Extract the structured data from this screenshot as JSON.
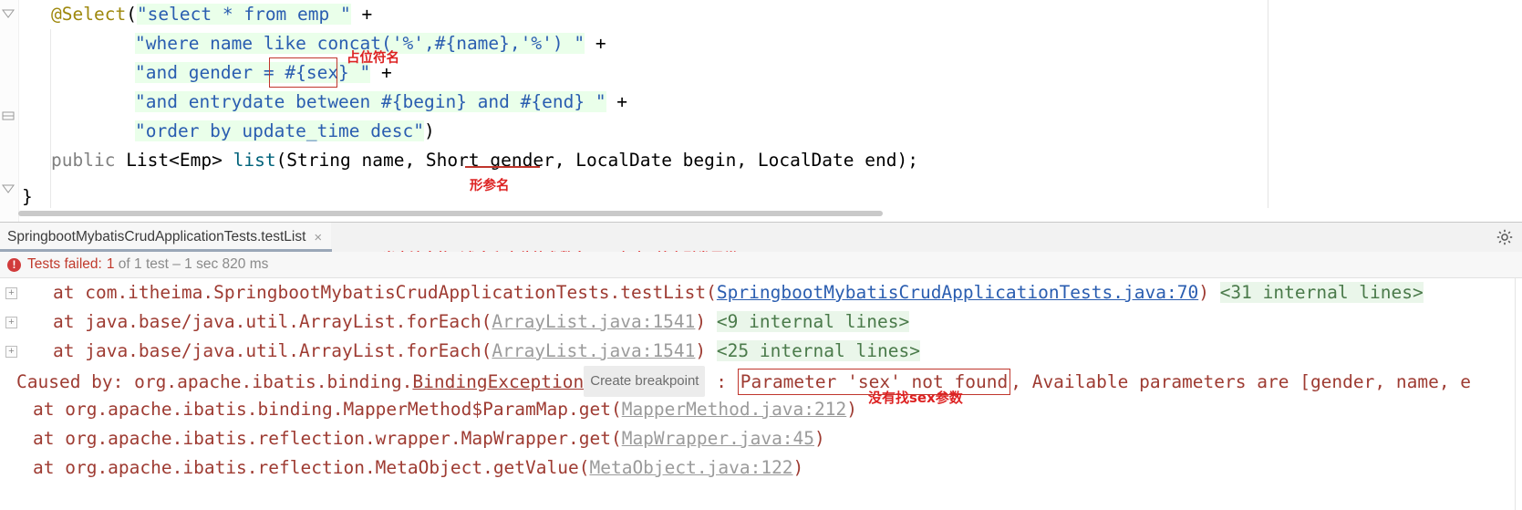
{
  "colors": {
    "accent_red": "#dd2222",
    "box_red": "#c0362c",
    "error_text": "#9e3b32",
    "link_blue": "#2a5db0",
    "sql_highlight": "#eaffea",
    "internal_highlight": "#eaf6ea",
    "tab_underline": "#9aa7b8",
    "badge_red": "#d13b3b"
  },
  "editor": {
    "lines": [
      {
        "id": "line-select-annotation",
        "tokens": [
          {
            "text": "@Select",
            "cls": "t-anno"
          },
          {
            "text": "(",
            "cls": "t-plain"
          },
          {
            "text": "\"select * from emp \"",
            "cls": "t-str hl-sql"
          },
          {
            "text": " + ",
            "cls": "t-plain"
          }
        ]
      },
      {
        "id": "line-where-name-like",
        "tokens": [
          {
            "text": "\"where name like concat('%',#{name},'%') \"",
            "cls": "t-str hl-sql"
          },
          {
            "text": " + ",
            "cls": "t-plain"
          }
        ]
      },
      {
        "id": "line-and-gender",
        "tokens": [
          {
            "text": "\"and gender = #{sex} \"",
            "cls": "t-str hl-sql"
          },
          {
            "text": " + ",
            "cls": "t-plain"
          }
        ]
      },
      {
        "id": "line-and-entrydate",
        "tokens": [
          {
            "text": "\"and entrydate between #{begin} and #{end} \"",
            "cls": "t-str hl-sql"
          },
          {
            "text": " + ",
            "cls": "t-plain"
          }
        ]
      },
      {
        "id": "line-order-by",
        "tokens": [
          {
            "text": "\"order by update_time desc\"",
            "cls": "t-str hl-sql"
          },
          {
            "text": ")",
            "cls": "t-plain"
          }
        ]
      },
      {
        "id": "line-method-signature",
        "tokens": [
          {
            "text": "public",
            "cls": "t-mod"
          },
          {
            "text": " List<Emp> ",
            "cls": "t-type"
          },
          {
            "text": "list",
            "cls": "t-method"
          },
          {
            "text": "(String name, Short gender, LocalDate begin, LocalDate end);",
            "cls": "t-plain"
          }
        ]
      },
      {
        "id": "line-class-close",
        "tokens": [
          {
            "text": "}",
            "cls": "t-plain"
          }
        ]
      }
    ],
    "annotations": [
      {
        "name": "placeholder-name-note",
        "text": "占位符名"
      },
      {
        "name": "formal-parameter-name-note",
        "text": "形参名"
      }
    ]
  },
  "panel": {
    "tab": {
      "label": "SpringbootMybatisCrudApplicationTests.testList",
      "close_icon": "×"
    },
    "gear_icon": "gear-icon",
    "note": "当方法中的形参名和占位符参数名不一致时，就会引发异常",
    "status": {
      "badge_icon": "error-icon",
      "badge_glyph": "!",
      "label": "Tests failed:",
      "count": "1",
      "of_text": " of 1 test – 1 sec 820 ms"
    },
    "trace": [
      {
        "id": "trace-testlist",
        "expander": "+",
        "segments": [
          {
            "text": "at com.itheima.SpringbootMybatisCrudApplicationTests.testList(",
            "cls": "tr-err"
          },
          {
            "text": "SpringbootMybatisCrudApplicationTests.java:70",
            "cls": "tr-link"
          },
          {
            "text": ") ",
            "cls": "tr-err"
          },
          {
            "text": "<31 internal lines>",
            "cls": "tr-intern"
          }
        ]
      },
      {
        "id": "trace-foreach-9",
        "expander": "+",
        "segments": [
          {
            "text": "at java.base/java.util.ArrayList.forEach(",
            "cls": "tr-err"
          },
          {
            "text": "ArrayList.java:1541",
            "cls": "tr-gray"
          },
          {
            "text": ") ",
            "cls": "tr-err"
          },
          {
            "text": "<9 internal lines>",
            "cls": "tr-intern"
          }
        ]
      },
      {
        "id": "trace-foreach-25",
        "expander": "+",
        "segments": [
          {
            "text": "at java.base/java.util.ArrayList.forEach(",
            "cls": "tr-err"
          },
          {
            "text": "ArrayList.java:1541",
            "cls": "tr-gray"
          },
          {
            "text": ") ",
            "cls": "tr-err"
          },
          {
            "text": "<25 internal lines>",
            "cls": "tr-intern"
          }
        ]
      },
      {
        "id": "trace-caused-by",
        "expander": "",
        "segments": [
          {
            "text": "Caused by: org.apache.ibatis.binding.",
            "cls": "tr-err"
          },
          {
            "text": "BindingException",
            "cls": "tr-under"
          },
          {
            "text": "__BREAKPOINT__",
            "cls": "breakpoint"
          },
          {
            "text": " : ",
            "cls": "tr-err"
          },
          {
            "text": "Parameter 'sex' not found",
            "cls": "param-box tr-err"
          },
          {
            "text": ", Available parameters are [gender, name, e",
            "cls": "tr-err"
          }
        ]
      },
      {
        "id": "trace-parammap-get",
        "expander": "",
        "segments": [
          {
            "text": "at org.apache.ibatis.binding.MapperMethod$ParamMap.get(",
            "cls": "tr-err"
          },
          {
            "text": "MapperMethod.java:212",
            "cls": "tr-gray"
          },
          {
            "text": ")",
            "cls": "tr-err"
          }
        ]
      },
      {
        "id": "trace-mapwrapper-get",
        "expander": "",
        "segments": [
          {
            "text": "at org.apache.ibatis.reflection.wrapper.MapWrapper.get(",
            "cls": "tr-err"
          },
          {
            "text": "MapWrapper.java:45",
            "cls": "tr-gray"
          },
          {
            "text": ")",
            "cls": "tr-err"
          }
        ]
      },
      {
        "id": "trace-metaobject-getvalue",
        "expander": "",
        "segments": [
          {
            "text": "at org.apache.ibatis.reflection.MetaObject.getValue(",
            "cls": "tr-err"
          },
          {
            "text": "MetaObject.java:122",
            "cls": "tr-gray"
          },
          {
            "text": ")",
            "cls": "tr-err"
          }
        ]
      }
    ],
    "breakpoint_hint": "Create breakpoint",
    "trace_note": "没有找sex参数"
  }
}
